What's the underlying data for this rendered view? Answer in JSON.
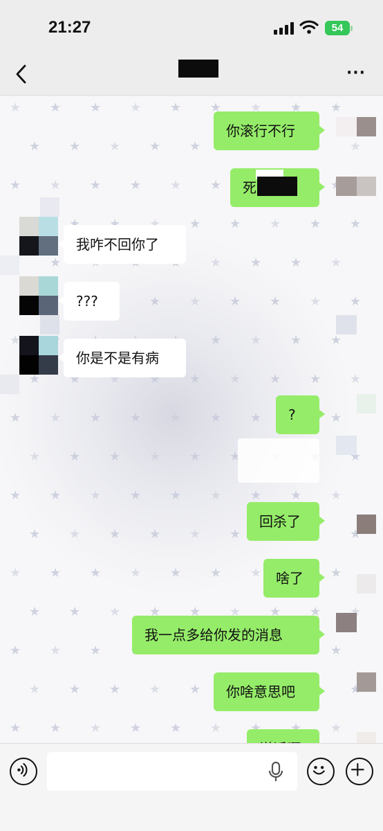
{
  "status_bar": {
    "time": "21:27",
    "battery": "54"
  },
  "nav": {
    "back_icon": "chevron-left-icon",
    "more_icon": "more-dots-icon",
    "more_label": "···"
  },
  "messages": [
    {
      "side": "out",
      "text": "你滚行不行"
    },
    {
      "side": "out",
      "text": "死"
    },
    {
      "side": "in",
      "text": "我咋不回你了"
    },
    {
      "side": "in",
      "text": "???"
    },
    {
      "side": "in",
      "text": "你是不是有病"
    },
    {
      "side": "out",
      "text": "?"
    },
    {
      "side": "out",
      "text": "回杀了"
    },
    {
      "side": "out",
      "text": "啥了"
    },
    {
      "side": "out",
      "text": "我一点多给你发的消息"
    },
    {
      "side": "out",
      "text": "你啥意思吧"
    },
    {
      "side": "out",
      "text": "说话啊"
    }
  ],
  "input_bar": {
    "placeholder": "",
    "voice_icon": "voice-icon",
    "mic_icon": "microphone-icon",
    "emoji_icon": "emoji-icon",
    "plus_icon": "plus-icon"
  },
  "colors": {
    "outgoing_bubble": "#95ec69",
    "incoming_bubble": "#ffffff",
    "battery": "#34c759"
  }
}
